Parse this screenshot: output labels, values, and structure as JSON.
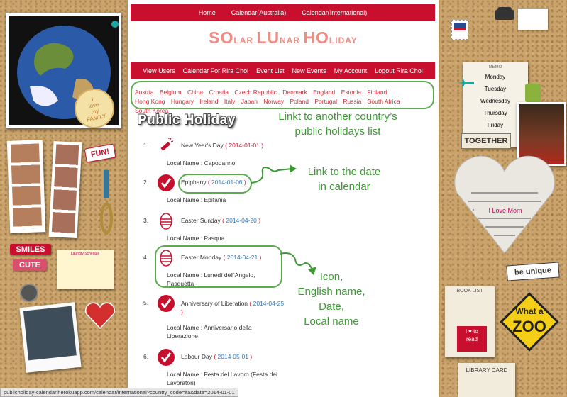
{
  "top_nav": [
    "Home",
    "Calendar(Australia)",
    "Calendar(International)"
  ],
  "logo": {
    "parts": [
      {
        "big": "SO",
        "small": "LAR "
      },
      {
        "big": "LU",
        "small": "NAR "
      },
      {
        "big": "HO",
        "small": "LIDAY"
      }
    ]
  },
  "main_nav": [
    "View Users",
    "Calendar For Rira Choi",
    "Event List",
    "New Events",
    "My Account",
    "Logout Rira Choi"
  ],
  "countries": [
    "Austria",
    "Belgium",
    "China",
    "Croatia",
    "Czech Republic",
    "Denmark",
    "England",
    "Estonia",
    "Finland",
    "Hong Kong",
    "Hungary",
    "Ireland",
    "Italy",
    "Japan",
    "Norway",
    "Poland",
    "Portugal",
    "Russia",
    "South Africa",
    "South Korea"
  ],
  "section_title": "Public Holiday",
  "local_name_label": "Local Name : ",
  "holidays": [
    {
      "num": "1.",
      "icon": "firecracker-icon",
      "name": "New Year's Day",
      "date": "2014-01-01",
      "local": "Capodanno"
    },
    {
      "num": "2.",
      "icon": "checkmark-icon",
      "name": "Epiphany",
      "date": "2014-01-06",
      "local": "Epifania"
    },
    {
      "num": "3.",
      "icon": "easter-egg-icon",
      "name": "Easter Sunday",
      "date": "2014-04-20",
      "local": "Pasqua"
    },
    {
      "num": "4.",
      "icon": "easter-egg-icon",
      "name": "Easter Monday",
      "date": "2014-04-21",
      "local": "Lunedì dell'Angelo, Pasquetta"
    },
    {
      "num": "5.",
      "icon": "checkmark-icon",
      "name": "Anniversary of Liberation",
      "date": "2014-04-25",
      "local": "Anniversario della Liberazione"
    },
    {
      "num": "6.",
      "icon": "checkmark-icon",
      "name": "Labour Day",
      "date": "2014-05-01",
      "local": "Festa del Lavoro (Festa dei Lavoratori)"
    }
  ],
  "annotations": {
    "countries_note": [
      "Linkt to another country’s",
      "public holidays list"
    ],
    "date_note": [
      "Link to the date",
      "in calendar"
    ],
    "item_note": [
      "Icon,",
      "English name,",
      "Date,",
      "Local name"
    ]
  },
  "status_url": "publicholiday-calendar.herokuapp.com/calendar/international?country_code=ita&date=2014-01-01",
  "decor": {
    "fun": "FUN!",
    "smiles": "SMILES",
    "cute": "CUTE",
    "love_family": [
      "I",
      "love",
      "my",
      "FAMILY"
    ],
    "memo_title": "MEMO",
    "memo_days": [
      "Monday",
      "Tuesday",
      "Wednesday",
      "Thursday",
      "Friday"
    ],
    "together": "TOGETHER",
    "i_love_mom": "I Love Mom",
    "be_unique": "be unique",
    "book_list": "BOOK LIST",
    "what_a": "What a",
    "zoo": "ZOO",
    "i_love_read": [
      "i",
      "to",
      "read"
    ],
    "library_card": "LIBRARY CARD",
    "laundry": "Laundry Schedule"
  },
  "colors": {
    "brand_red": "#c8102e",
    "link_blue": "#2e79c0",
    "annotation_green": "#3e9a35"
  }
}
